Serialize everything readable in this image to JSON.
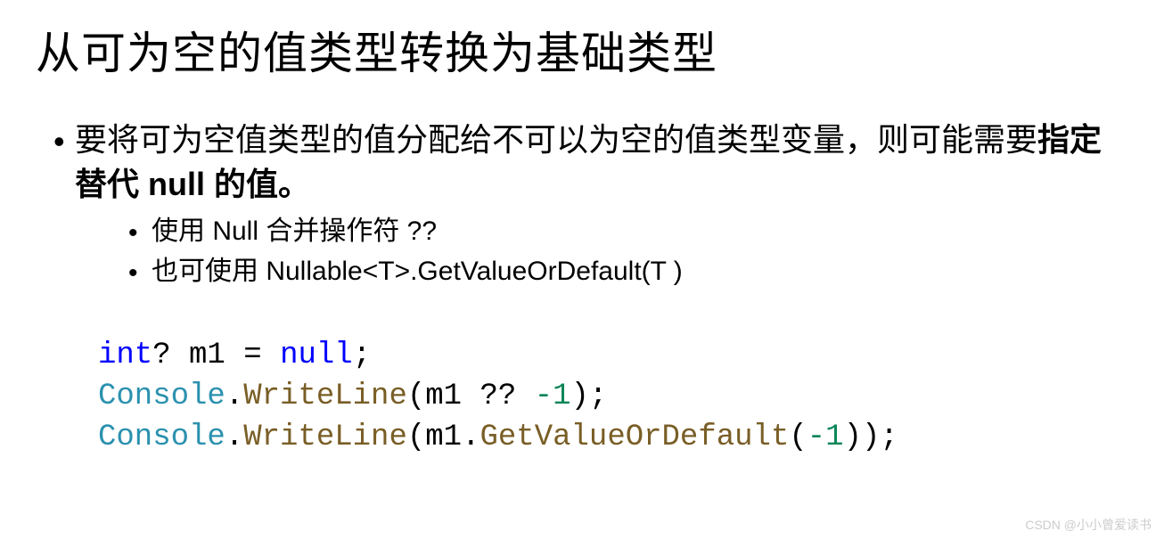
{
  "title": "从可为空的值类型转换为基础类型",
  "bullets": {
    "main_part1": "要将可为空值类型的值分配给不可以为空的值类型变量，则可能需要",
    "main_bold": "指定替代 null 的值。",
    "sub1": "使用 Null 合并操作符 ??",
    "sub2": "也可使用 Nullable<T>.GetValueOrDefault(T )"
  },
  "code": {
    "l1_kw": "int",
    "l1_q": "?",
    "l1_var": " m1 ",
    "l1_eq": "= ",
    "l1_null": "null",
    "l1_semi": ";",
    "l2_cls": "Console",
    "l2_dot": ".",
    "l2_mth": "WriteLine",
    "l2_open": "(",
    "l2_arg": "m1 ?? ",
    "l2_num": "-1",
    "l2_close": ");",
    "l3_cls": "Console",
    "l3_dot": ".",
    "l3_mth": "WriteLine",
    "l3_open": "(",
    "l3_arg1": "m1",
    "l3_dot2": ".",
    "l3_mth2": "GetValueOrDefault",
    "l3_open2": "(",
    "l3_num": "-1",
    "l3_close": "));"
  },
  "watermark": "CSDN @小小曾爱读书"
}
